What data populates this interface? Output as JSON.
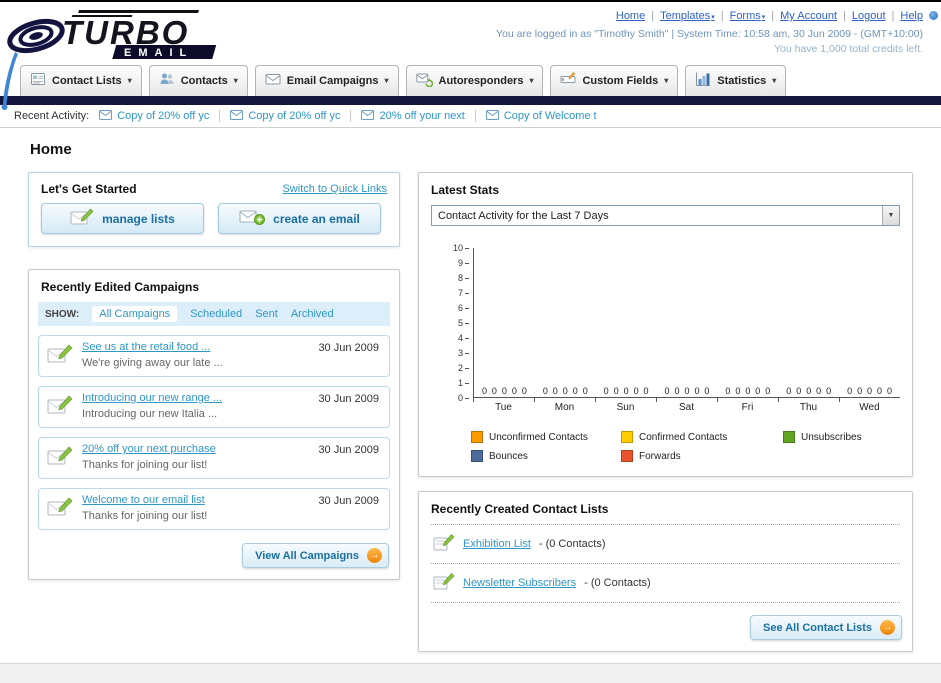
{
  "ui": {
    "separator": "|",
    "caret": "▾",
    "select_caret": "▼",
    "arrow": "→"
  },
  "header": {
    "logo_main": "TURBO",
    "logo_sub": "EMAIL",
    "nav": [
      {
        "label": "Home"
      },
      {
        "label": "Templates"
      },
      {
        "label": "Forms"
      },
      {
        "label": "My Account"
      },
      {
        "label": "Logout"
      },
      {
        "label": "Help"
      }
    ],
    "login_line": "You are logged in as \"Timothy Smith\" | System Time: 10:58 am, 30 Jun 2009 - (GMT+10:00)",
    "credits_line": "You have 1,000 total credits left."
  },
  "tabs": [
    {
      "label": "Contact Lists"
    },
    {
      "label": "Contacts"
    },
    {
      "label": "Email Campaigns"
    },
    {
      "label": "Autoresponders"
    },
    {
      "label": "Custom Fields"
    },
    {
      "label": "Statistics"
    }
  ],
  "recent_activity": {
    "label": "Recent Activity:",
    "items": [
      {
        "label": "Copy of 20% off yc"
      },
      {
        "label": "Copy of 20% off yc"
      },
      {
        "label": "20% off your next"
      },
      {
        "label": "Copy of Welcome t"
      }
    ]
  },
  "page": {
    "heading": "Home"
  },
  "get_started": {
    "title": "Let's Get Started",
    "switch_link": "Switch to Quick Links",
    "manage_lists_label": "manage lists",
    "create_email_label": "create an email"
  },
  "campaigns": {
    "title": "Recently Edited Campaigns",
    "show_label": "SHOW:",
    "filters": [
      {
        "label": "All Campaigns",
        "selected": true
      },
      {
        "label": "Scheduled"
      },
      {
        "label": "Sent"
      },
      {
        "label": "Archived"
      }
    ],
    "items": [
      {
        "title": "See us at the retail food ...",
        "subtitle": "We're giving away our late ...",
        "date": "30 Jun 2009"
      },
      {
        "title": "Introducing our new range ...",
        "subtitle": "Introducing our new Italia ...",
        "date": "30 Jun 2009"
      },
      {
        "title": "20% off your next purchase",
        "subtitle": "Thanks for joining our list!",
        "date": "30 Jun 2009"
      },
      {
        "title": "Welcome to our email list",
        "subtitle": "Thanks for joining our list!",
        "date": "30 Jun 2009"
      }
    ],
    "view_all_label": "View All Campaigns"
  },
  "stats": {
    "title": "Latest Stats",
    "dropdown_value": "Contact Activity for the Last 7 Days",
    "legend": [
      {
        "label": "Unconfirmed Contacts",
        "color": "#ff9900"
      },
      {
        "label": "Confirmed Contacts",
        "color": "#ffcc00"
      },
      {
        "label": "Unsubscribes",
        "color": "#61a523"
      },
      {
        "label": "Bounces",
        "color": "#4a6d9d"
      },
      {
        "label": "Forwards",
        "color": "#e8532a"
      }
    ],
    "chart_data": {
      "type": "bar",
      "title": "Contact Activity for the Last 7 Days",
      "categories": [
        "Tue",
        "Mon",
        "Sun",
        "Sat",
        "Fri",
        "Thu",
        "Wed"
      ],
      "series": [
        {
          "name": "Unconfirmed Contacts",
          "color": "#ff9900",
          "values": [
            0,
            0,
            0,
            0,
            0,
            0,
            0
          ]
        },
        {
          "name": "Confirmed Contacts",
          "color": "#ffcc00",
          "values": [
            0,
            0,
            0,
            0,
            0,
            0,
            0
          ]
        },
        {
          "name": "Unsubscribes",
          "color": "#61a523",
          "values": [
            0,
            0,
            0,
            0,
            0,
            0,
            0
          ]
        },
        {
          "name": "Bounces",
          "color": "#4a6d9d",
          "values": [
            0,
            0,
            0,
            0,
            0,
            0,
            0
          ]
        },
        {
          "name": "Forwards",
          "color": "#e8532a",
          "values": [
            0,
            0,
            0,
            0,
            0,
            0,
            0
          ]
        }
      ],
      "ylim": [
        0,
        10
      ],
      "yticks": [
        0,
        1,
        2,
        3,
        4,
        5,
        6,
        7,
        8,
        9,
        10
      ]
    }
  },
  "contact_lists": {
    "title": "Recently Created Contact Lists",
    "items": [
      {
        "name": "Exhibition List",
        "count": "- (0 Contacts)"
      },
      {
        "name": "Newsletter Subscribers",
        "count": "- (0 Contacts)"
      }
    ],
    "see_all_label": "See All Contact Lists"
  }
}
